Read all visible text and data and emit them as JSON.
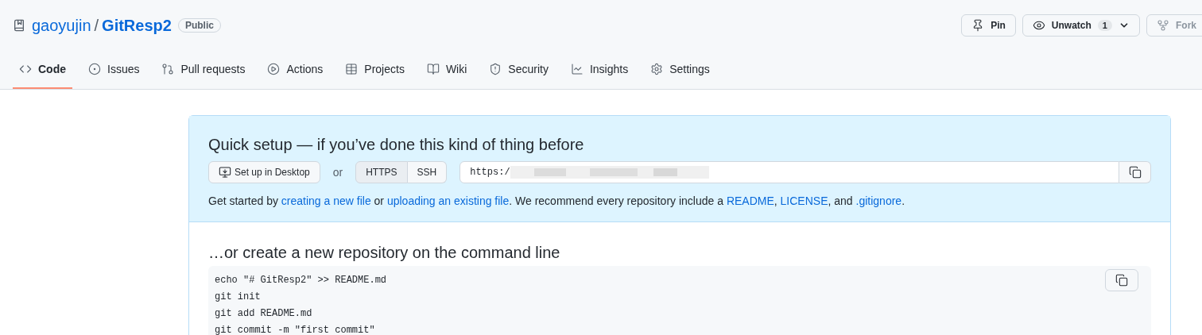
{
  "repo": {
    "owner": "gaoyujin",
    "separator": "/",
    "name": "GitResp2",
    "visibility": "Public"
  },
  "actions": [
    {
      "kind": "pin",
      "label": "Pin",
      "disabled": false
    },
    {
      "kind": "watch",
      "label": "Unwatch",
      "count": "1",
      "disabled": false
    },
    {
      "kind": "fork",
      "label": "Fork",
      "disabled": true
    }
  ],
  "tabs": [
    {
      "label": "Code",
      "selected": true
    },
    {
      "label": "Issues",
      "selected": false
    },
    {
      "label": "Pull requests",
      "selected": false
    },
    {
      "label": "Actions",
      "selected": false
    },
    {
      "label": "Projects",
      "selected": false
    },
    {
      "label": "Wiki",
      "selected": false
    },
    {
      "label": "Security",
      "selected": false
    },
    {
      "label": "Insights",
      "selected": false
    },
    {
      "label": "Settings",
      "selected": false
    }
  ],
  "quick_setup": {
    "title": "Quick setup — if you’ve done this kind of thing before",
    "desktop_button": "Set up in Desktop",
    "or": "or",
    "protocols": [
      {
        "label": "HTTPS",
        "selected": true
      },
      {
        "label": "SSH",
        "selected": false
      }
    ],
    "url": "https:/",
    "intro": [
      {
        "kind": "text",
        "text": "Get started by "
      },
      {
        "kind": "link",
        "text": "creating a new file"
      },
      {
        "kind": "text",
        "text": " or "
      },
      {
        "kind": "link",
        "text": "uploading an existing file"
      },
      {
        "kind": "text",
        "text": ". We recommend every repository include a "
      },
      {
        "kind": "link",
        "text": "README"
      },
      {
        "kind": "text",
        "text": ", "
      },
      {
        "kind": "link",
        "text": "LICENSE"
      },
      {
        "kind": "text",
        "text": ", and "
      },
      {
        "kind": "link",
        "text": ".gitignore"
      },
      {
        "kind": "text",
        "text": "."
      }
    ]
  },
  "command_line": {
    "title": "…or create a new repository on the command line",
    "lines": [
      "echo \"# GitResp2\" >> README.md",
      "git init",
      "git add README.md",
      "git commit -m \"first commit\""
    ]
  }
}
